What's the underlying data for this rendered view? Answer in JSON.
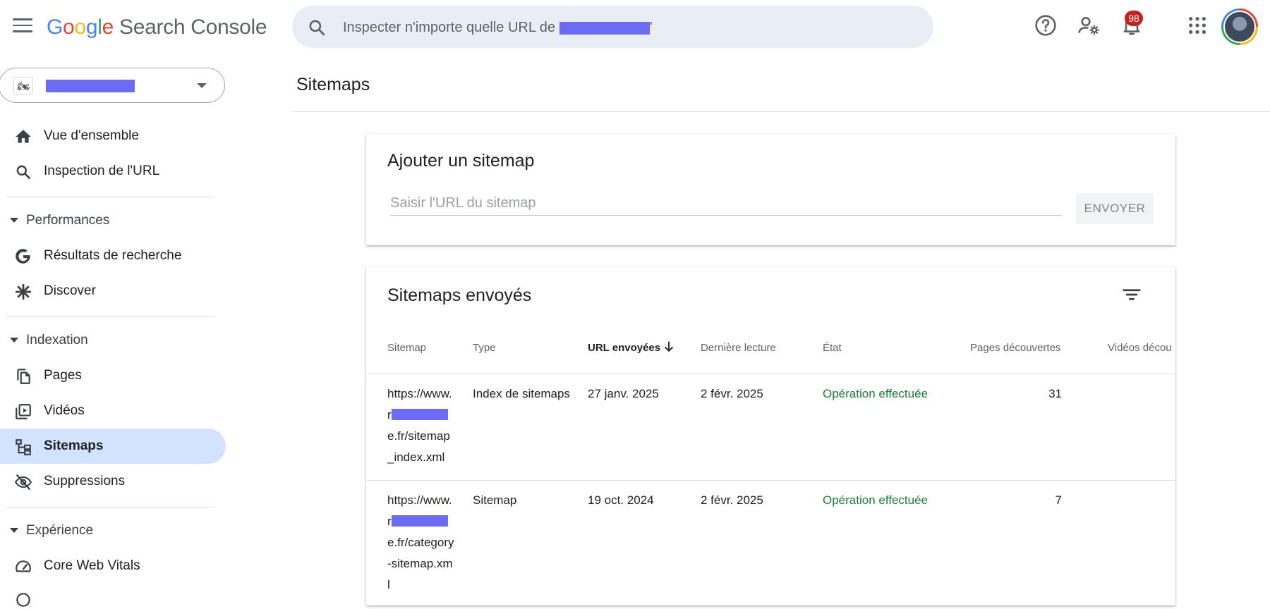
{
  "app": {
    "logo_letters": [
      "G",
      "o",
      "o",
      "g",
      "l",
      "e"
    ],
    "product": "Search Console"
  },
  "search": {
    "placeholder": "Inspecter n'importe quelle URL de",
    "suffix": "'"
  },
  "notifications": {
    "count": "98"
  },
  "property": {
    "favicon": "🏍"
  },
  "sidebar": {
    "items_top": [
      {
        "label": "Vue d'ensemble",
        "icon": "home-icon"
      },
      {
        "label": "Inspection de l'URL",
        "icon": "search-icon"
      }
    ],
    "sections": [
      {
        "label": "Performances",
        "items": [
          {
            "label": "Résultats de recherche",
            "icon": "google-g-icon"
          },
          {
            "label": "Discover",
            "icon": "asterisk-icon"
          }
        ]
      },
      {
        "label": "Indexation",
        "items": [
          {
            "label": "Pages",
            "icon": "pages-icon"
          },
          {
            "label": "Vidéos",
            "icon": "video-icon"
          },
          {
            "label": "Sitemaps",
            "icon": "sitemap-icon",
            "active": true
          },
          {
            "label": "Suppressions",
            "icon": "eye-off-icon"
          }
        ]
      },
      {
        "label": "Expérience",
        "items": [
          {
            "label": "Core Web Vitals",
            "icon": "gauge-icon"
          }
        ]
      }
    ]
  },
  "main": {
    "title": "Sitemaps",
    "add_card": {
      "title": "Ajouter un sitemap",
      "placeholder": "Saisir l'URL du sitemap",
      "button": "ENVOYER"
    },
    "submitted": {
      "title": "Sitemaps envoyés",
      "columns": [
        "Sitemap",
        "Type",
        "URL envoyées",
        "Dernière lecture",
        "État",
        "Pages découvertes",
        "Vidéos décou"
      ],
      "rows": [
        {
          "url_start": "https://www.r",
          "url_end": "e.fr/sitemap_index.xml",
          "type": "Index de sitemaps",
          "submitted": "27 janv. 2025",
          "last_read": "2 févr. 2025",
          "status": "Opération effectuée",
          "pages": "31"
        },
        {
          "url_start": "https://www.r",
          "url_end": "e.fr/category-sitemap.xml",
          "type": "Sitemap",
          "submitted": "19 oct. 2024",
          "last_read": "2 févr. 2025",
          "status": "Opération effectuée",
          "pages": "7"
        }
      ]
    }
  },
  "colors": {
    "accent_active": "#d3e3fd",
    "status_ok": "#188038",
    "redaction": "#6b6bf5",
    "badge": "#c5221f"
  }
}
